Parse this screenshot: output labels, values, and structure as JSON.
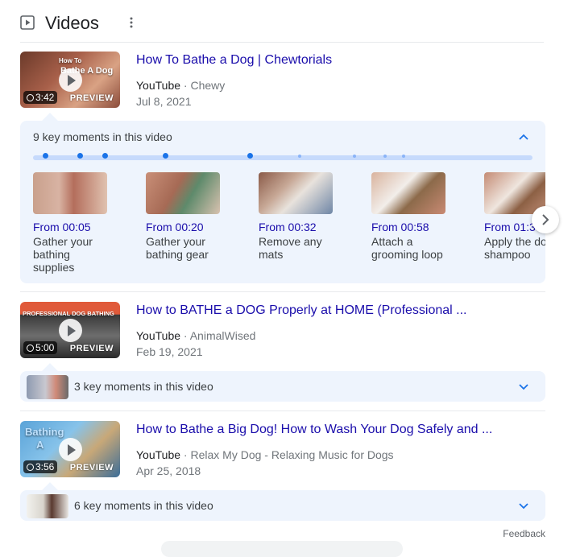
{
  "header": {
    "title": "Videos"
  },
  "videos": [
    {
      "title": "How To Bathe a Dog | Chewtorials",
      "source": "YouTube",
      "separator": "·",
      "channel": "Chewy",
      "date": "Jul 8, 2021",
      "duration": "3:42",
      "preview": "PREVIEW",
      "thumb_text": [
        "How To",
        "Bathe A Dog"
      ]
    },
    {
      "title": "How to BATHE a DOG Properly at HOME (Professional ...",
      "source": "YouTube",
      "separator": "·",
      "channel": "AnimalWised",
      "date": "Feb 19, 2021",
      "duration": "5:00",
      "preview": "PREVIEW",
      "thumb_text": [
        "PROFESSIONAL DOG BATHING"
      ]
    },
    {
      "title": "How to Bathe a Big Dog! How to Wash Your Dog Safely and ...",
      "source": "YouTube",
      "separator": "·",
      "channel": "Relax My Dog - Relaxing Music for Dogs",
      "date": "Apr 25, 2018",
      "duration": "3:56",
      "preview": "PREVIEW",
      "thumb_text": [
        "Bathing",
        "A"
      ]
    }
  ],
  "key_moments_expanded": {
    "label": "9 key moments in this video",
    "moments": [
      {
        "time": "From 00:05",
        "label": "Gather your bathing supplies"
      },
      {
        "time": "From 00:20",
        "label": "Gather your bathing gear"
      },
      {
        "time": "From 00:32",
        "label": "Remove any mats"
      },
      {
        "time": "From 00:58",
        "label": "Attach a grooming loop"
      },
      {
        "time": "From 01:3",
        "label": "Apply the do shampoo"
      }
    ]
  },
  "key_moments_collapsed": [
    {
      "label": "3 key moments in this video"
    },
    {
      "label": "6 key moments in this video"
    }
  ],
  "footer": {
    "feedback": "Feedback"
  },
  "colors": {
    "link": "#1a0dab",
    "accent": "#1a73e8",
    "panel": "#eef4fd"
  }
}
